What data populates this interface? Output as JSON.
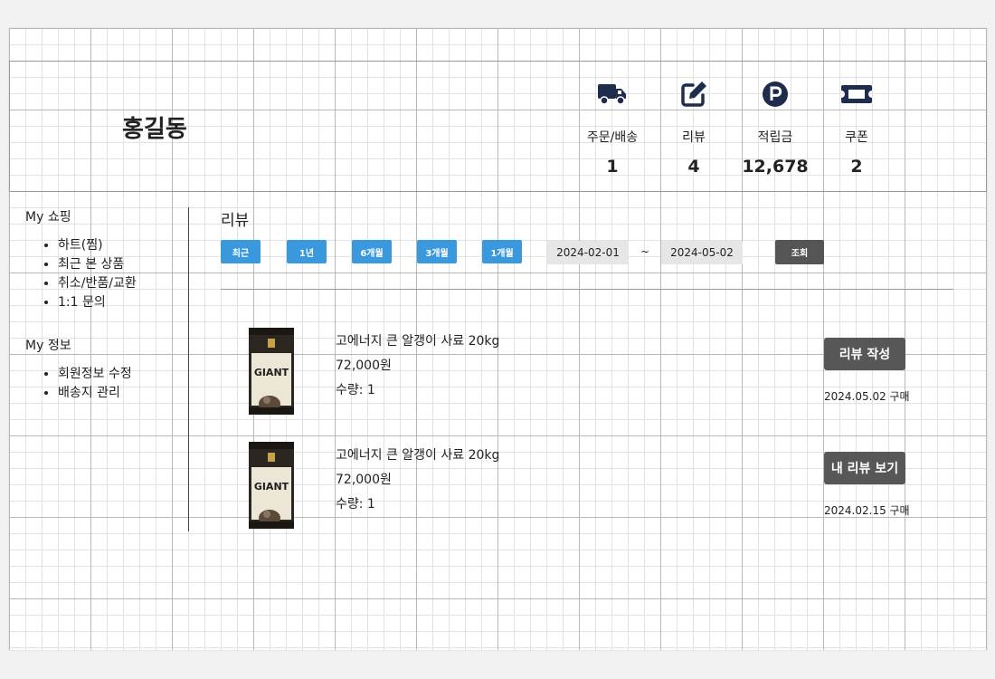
{
  "profile": {
    "user_name": "홍길동",
    "stats": [
      {
        "icon": "truck-icon",
        "label": "주문/배송",
        "value": "1"
      },
      {
        "icon": "edit-icon",
        "label": "리뷰",
        "value": "4"
      },
      {
        "icon": "points-icon",
        "label": "적립금",
        "value": "12,678"
      },
      {
        "icon": "ticket-icon",
        "label": "쿠폰",
        "value": "2"
      }
    ]
  },
  "sidebar": {
    "shopping_heading": "My 쇼핑",
    "shopping_items": [
      "하트(찜)",
      "최근 본 상품",
      "취소/반품/교환",
      "1:1 문의"
    ],
    "info_heading": "My 정보",
    "info_items": [
      "회원정보 수정",
      "배송지 관리"
    ]
  },
  "content": {
    "title": "리뷰",
    "filters": [
      "최근",
      "1년",
      "6개월",
      "3개월",
      "1개월"
    ],
    "date_from": "2024-02-01",
    "date_separator": "~",
    "date_to": "2024-05-02",
    "query_label": "조회"
  },
  "reviews": [
    {
      "image_text": "GIANT",
      "name": "고에너지 큰 알갱이 사료 20kg",
      "price": "72,000원",
      "quantity": "수량: 1",
      "button": "리뷰 작성",
      "date": "2024.05.02 구매"
    },
    {
      "image_text": "GIANT",
      "name": "고에너지 큰 알갱이 사료 20kg",
      "price": "72,000원",
      "quantity": "수량: 1",
      "button": "내 리뷰 보기",
      "date": "2024.02.15 구매"
    }
  ],
  "colors": {
    "icon": "#1e2d4d",
    "filter_button": "#3a98dc",
    "dark_button": "#575757"
  }
}
